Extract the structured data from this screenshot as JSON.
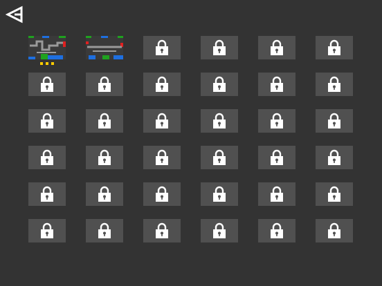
{
  "header": {
    "back_icon": "back-triangle-icon"
  },
  "colors": {
    "background": "#333333",
    "locked_tile": "#505050",
    "lock": "#ffffff",
    "star": "#ffcc00",
    "pipe_gray": "#9a9a9a",
    "block_green": "#1fa21f",
    "block_blue": "#1e6fe0",
    "block_red": "#e02020"
  },
  "levels": {
    "columns": 6,
    "rows": 6,
    "unlocked": [
      {
        "level": 1,
        "stars": 3
      },
      {
        "level": 2,
        "stars": 0
      }
    ],
    "locked_icon": "lock-icon"
  }
}
